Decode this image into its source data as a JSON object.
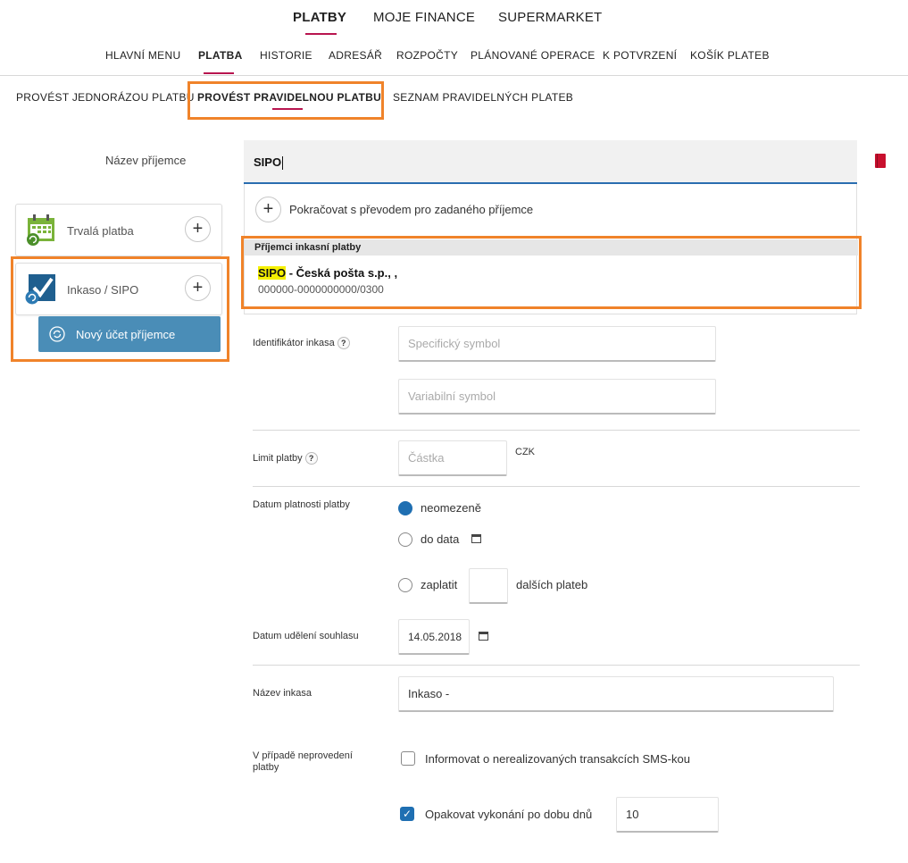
{
  "top_nav": {
    "items": [
      "PLATBY",
      "MOJE FINANCE",
      "SUPERMARKET"
    ]
  },
  "sub_nav": {
    "items": [
      "HLAVNÍ MENU",
      "PLATBA",
      "HISTORIE",
      "ADRESÁŘ",
      "ROZPOČTY",
      "PLÁNOVANÉ OPERACE",
      "K POTVRZENÍ",
      "KOŠÍK PLATEB"
    ]
  },
  "tabs": {
    "items": [
      "PROVÉST JEDNORÁZOU PLATBU",
      "PROVÉST PRAVIDELNOU PLATBU",
      "SEZNAM PRAVIDELNÝCH PLATEB"
    ]
  },
  "recipient": {
    "label": "Název příjemce",
    "value": "SIPO"
  },
  "dropdown": {
    "continue_label": "Pokračovat s převodem pro zadaného příjemce",
    "section_header": "Příjemci inkasní platby",
    "result_highlight": "SIPO",
    "result_name": " - Česká pošta s.p., ,",
    "result_account": "000000-0000000000/0300"
  },
  "payment_types": {
    "items": [
      {
        "label": "Trvalá platba",
        "icon": "calendar-icon"
      },
      {
        "label": "Inkaso / SIPO",
        "icon": "checkmark-icon"
      }
    ],
    "new_account_button": "Nový účet příjemce"
  },
  "form": {
    "identifier_label": "Identifikátor inkasa",
    "specific_symbol_placeholder": "Specifický symbol",
    "variable_symbol_placeholder": "Variabilní symbol",
    "limit_label": "Limit platby",
    "amount_placeholder": "Částka",
    "currency": "CZK",
    "validity_label": "Datum platnosti platby",
    "opt_unlimited": "neomezeně",
    "opt_until": "do data",
    "opt_pay": "zaplatit",
    "opt_pay_suffix": "dalších plateb",
    "consent_label": "Datum udělení souhlasu",
    "consent_date": "14.05.2018",
    "name_label": "Název inkasa",
    "name_value": "Inkaso -",
    "failure_label": "V případě neprovedení platby",
    "sms_label": "Informovat o nerealizovaných transakcích SMS-kou",
    "repeat_label": "Opakovat vykonání po dobu dnů",
    "repeat_value": "10"
  },
  "colors": {
    "accent": "#b8154f",
    "highlight_box": "#f0832a",
    "primary_button": "#4a8db7",
    "selected": "#1f6fb2"
  }
}
